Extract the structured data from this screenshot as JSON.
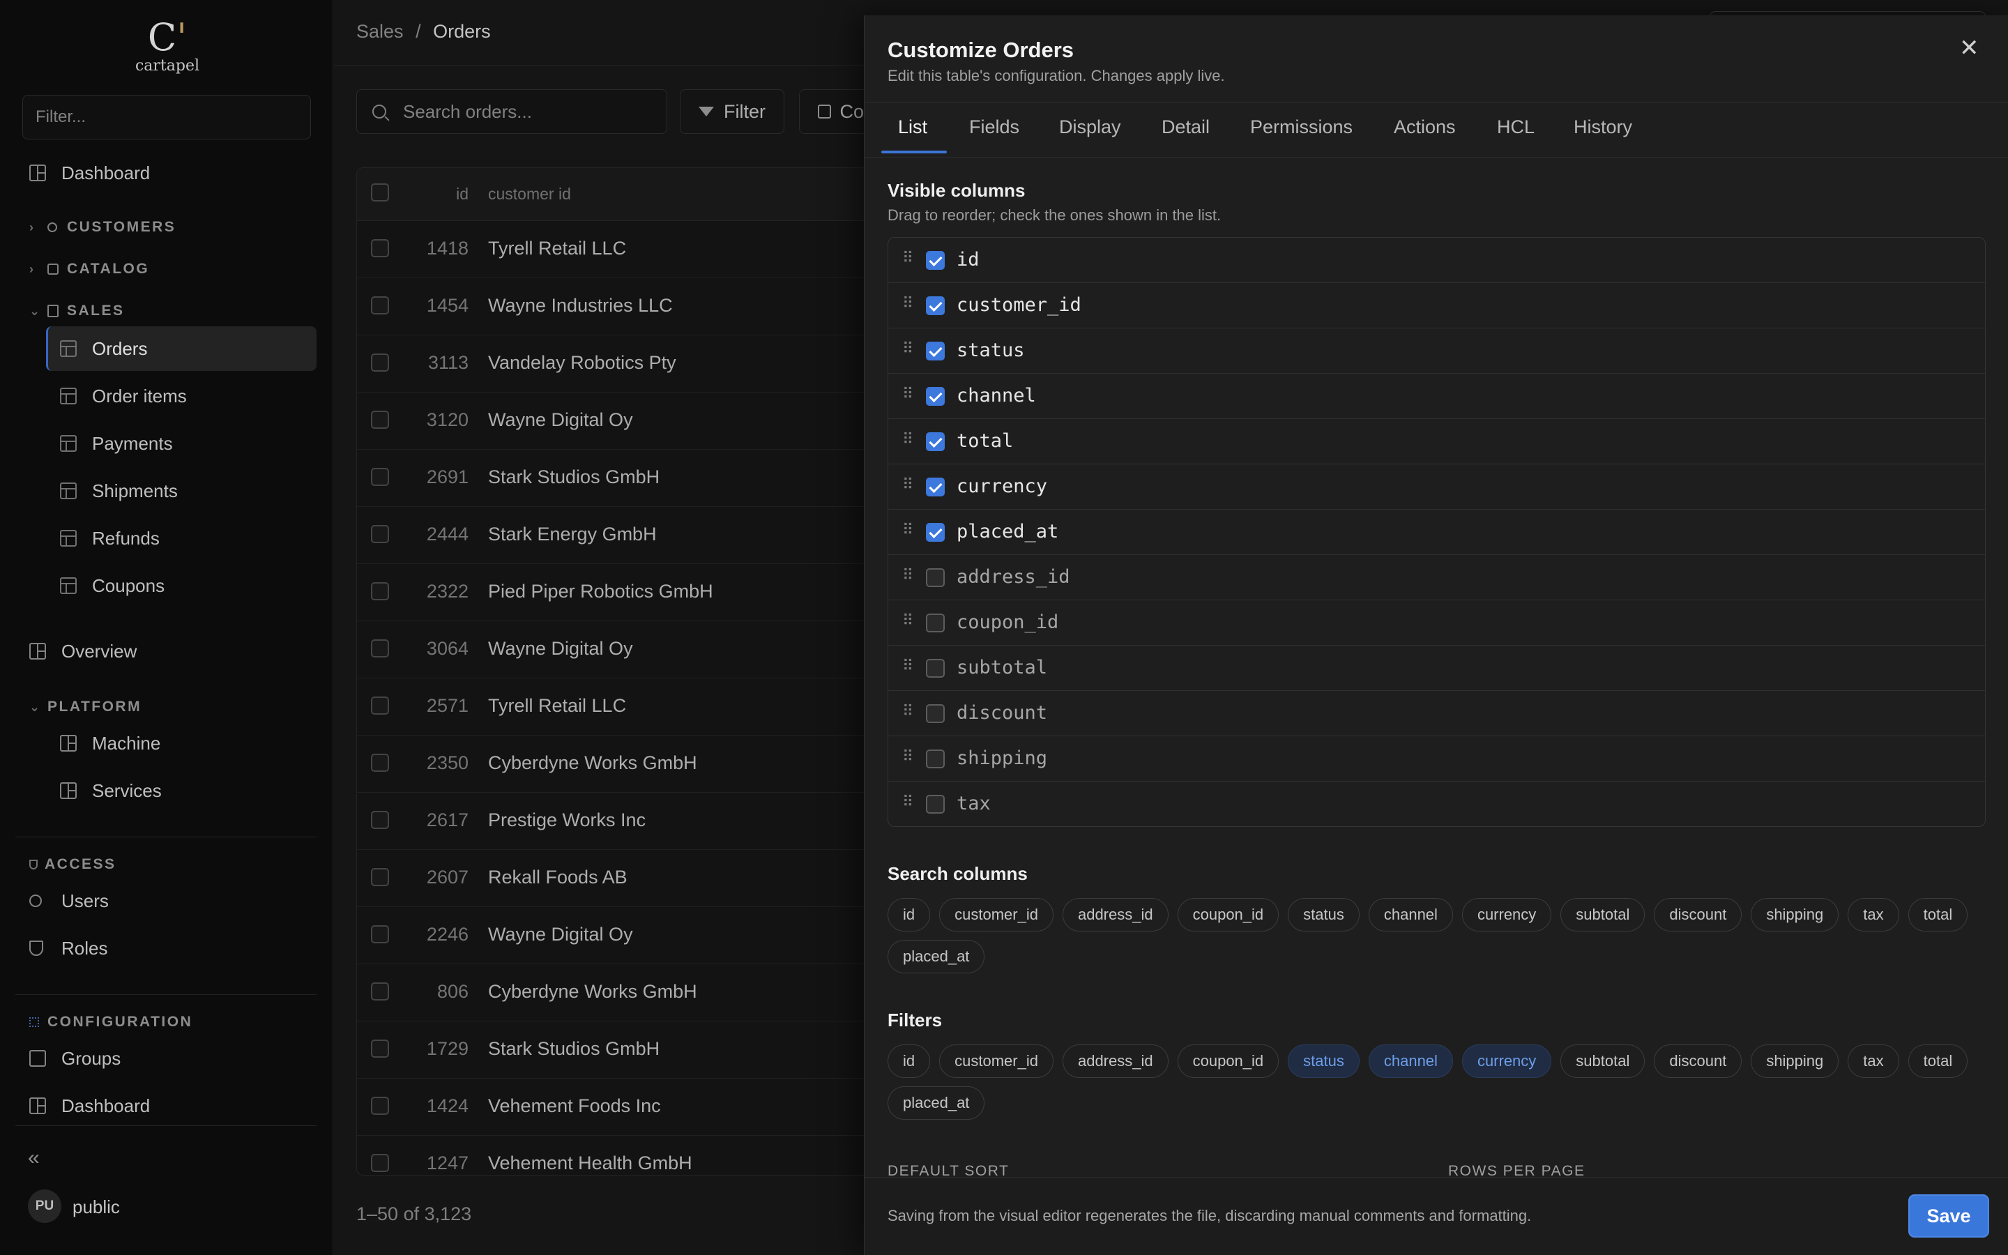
{
  "sidebar": {
    "logo_text": "cartapel",
    "filter_placeholder": "Filter...",
    "dashboard": "Dashboard",
    "sections": {
      "customers": "CUSTOMERS",
      "catalog": "CATALOG",
      "sales": "SALES",
      "platform": "PLATFORM",
      "access": "ACCESS",
      "configuration": "CONFIGURATION"
    },
    "sales_items": [
      "Orders",
      "Order items",
      "Payments",
      "Shipments",
      "Refunds",
      "Coupons"
    ],
    "overview": "Overview",
    "platform_items": [
      "Machine",
      "Services"
    ],
    "access_items": [
      "Users",
      "Roles"
    ],
    "configuration_items": [
      "Groups",
      "Dashboard"
    ],
    "collapse_glyph": "«",
    "user_initials": "PU",
    "user_name": "public"
  },
  "main": {
    "breadcrumb": {
      "parent": "Sales",
      "separator": "/",
      "current": "Orders"
    },
    "search_placeholder": "Search orders...",
    "filter_label": "Filter",
    "columns_label": "Co",
    "headers": {
      "id": "id",
      "customer": "customer id"
    },
    "rows": [
      {
        "id": "1418",
        "customer": "Tyrell Retail LLC"
      },
      {
        "id": "1454",
        "customer": "Wayne Industries LLC"
      },
      {
        "id": "3113",
        "customer": "Vandelay Robotics Pty"
      },
      {
        "id": "3120",
        "customer": "Wayne Digital Oy"
      },
      {
        "id": "2691",
        "customer": "Stark Studios GmbH"
      },
      {
        "id": "2444",
        "customer": "Stark Energy GmbH"
      },
      {
        "id": "2322",
        "customer": "Pied Piper Robotics GmbH"
      },
      {
        "id": "3064",
        "customer": "Wayne Digital Oy"
      },
      {
        "id": "2571",
        "customer": "Tyrell Retail LLC"
      },
      {
        "id": "2350",
        "customer": "Cyberdyne Works GmbH"
      },
      {
        "id": "2617",
        "customer": "Prestige Works Inc"
      },
      {
        "id": "2607",
        "customer": "Rekall Foods AB"
      },
      {
        "id": "2246",
        "customer": "Wayne Digital Oy"
      },
      {
        "id": "806",
        "customer": "Cyberdyne Works GmbH"
      },
      {
        "id": "1729",
        "customer": "Stark Studios GmbH"
      },
      {
        "id": "1424",
        "customer": "Vehement Foods Inc"
      },
      {
        "id": "1247",
        "customer": "Vehement Health GmbH"
      }
    ],
    "pagination": "1–50 of 3,123"
  },
  "drawer": {
    "title": "Customize Orders",
    "subtitle": "Edit this table's configuration. Changes apply live.",
    "close_glyph": "✕",
    "tabs": [
      "List",
      "Fields",
      "Display",
      "Detail",
      "Permissions",
      "Actions",
      "HCL",
      "History"
    ],
    "active_tab": "List",
    "visible_columns": {
      "title": "Visible columns",
      "subtitle": "Drag to reorder; check the ones shown in the list.",
      "items": [
        {
          "name": "id",
          "checked": true
        },
        {
          "name": "customer_id",
          "checked": true
        },
        {
          "name": "status",
          "checked": true
        },
        {
          "name": "channel",
          "checked": true
        },
        {
          "name": "total",
          "checked": true
        },
        {
          "name": "currency",
          "checked": true
        },
        {
          "name": "placed_at",
          "checked": true
        },
        {
          "name": "address_id",
          "checked": false
        },
        {
          "name": "coupon_id",
          "checked": false
        },
        {
          "name": "subtotal",
          "checked": false
        },
        {
          "name": "discount",
          "checked": false
        },
        {
          "name": "shipping",
          "checked": false
        },
        {
          "name": "tax",
          "checked": false
        }
      ]
    },
    "search_columns": {
      "title": "Search columns",
      "items": [
        "id",
        "customer_id",
        "address_id",
        "coupon_id",
        "status",
        "channel",
        "currency",
        "subtotal",
        "discount",
        "shipping",
        "tax",
        "total",
        "placed_at"
      ]
    },
    "filters": {
      "title": "Filters",
      "items": [
        "id",
        "customer_id",
        "address_id",
        "coupon_id",
        "status",
        "channel",
        "currency",
        "subtotal",
        "discount",
        "shipping",
        "tax",
        "total",
        "placed_at"
      ],
      "selected": [
        "status",
        "channel",
        "currency"
      ]
    },
    "default_sort_label": "DEFAULT SORT",
    "rows_per_page_label": "ROWS PER PAGE",
    "footer_note": "Saving from the visual editor regenerates the file, discarding manual comments and formatting.",
    "save_label": "Save"
  },
  "colors": {
    "accent": "#3a77db",
    "chip_selected_bg": "#1f2c44",
    "chip_selected_text": "#6e9ee8",
    "logo_accent": "#c9a46a"
  }
}
